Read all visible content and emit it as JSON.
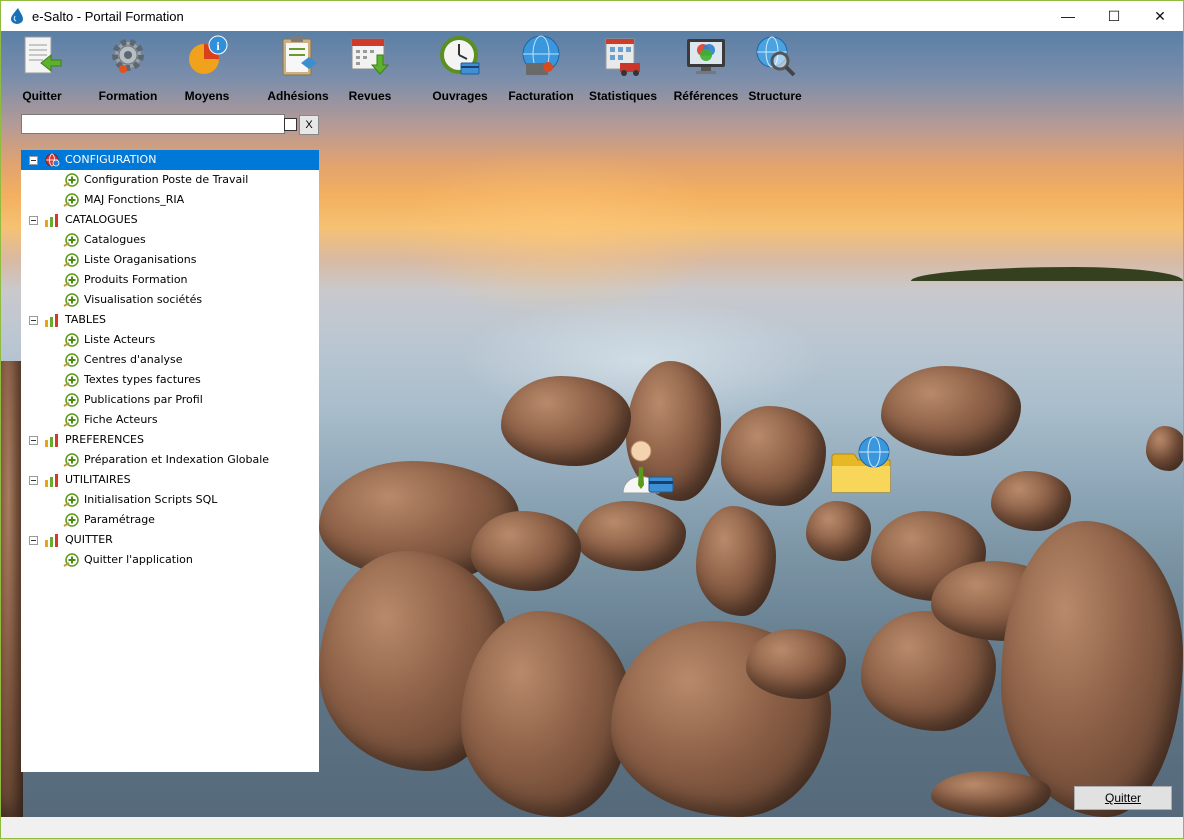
{
  "window": {
    "title": "e-Salto - Portail Formation",
    "minimize": "—",
    "maximize": "☐",
    "close": "✕"
  },
  "toolbar": [
    {
      "label": "Quitter",
      "icon": "document-exit-icon"
    },
    {
      "label": "Formation",
      "icon": "gear-icon"
    },
    {
      "label": "Moyens",
      "icon": "pie-info-icon"
    },
    {
      "label": "Adhésions",
      "icon": "clipboard-icon"
    },
    {
      "label": "Revues",
      "icon": "calendar-download-icon"
    },
    {
      "label": "Ouvrages",
      "icon": "clock-card-icon"
    },
    {
      "label": "Facturation",
      "icon": "globe-card-icon"
    },
    {
      "label": "Statistiques",
      "icon": "building-truck-icon"
    },
    {
      "label": "Références",
      "icon": "monitor-color-icon"
    },
    {
      "label": "Structure",
      "icon": "globe-search-icon"
    }
  ],
  "search": {
    "value": "",
    "clear_label": "X"
  },
  "tree": [
    {
      "type": "category",
      "label": "CONFIGURATION",
      "selected": true
    },
    {
      "type": "leaf",
      "label": "Configuration Poste de Travail"
    },
    {
      "type": "leaf",
      "label": "MAJ Fonctions_RIA"
    },
    {
      "type": "category",
      "label": "CATALOGUES"
    },
    {
      "type": "leaf",
      "label": "Catalogues"
    },
    {
      "type": "leaf",
      "label": "Liste Oraganisations"
    },
    {
      "type": "leaf",
      "label": "Produits Formation"
    },
    {
      "type": "leaf",
      "label": "Visualisation sociétés"
    },
    {
      "type": "category",
      "label": "TABLES"
    },
    {
      "type": "leaf",
      "label": "Liste Acteurs"
    },
    {
      "type": "leaf",
      "label": "Centres d'analyse"
    },
    {
      "type": "leaf",
      "label": "Textes types factures"
    },
    {
      "type": "leaf",
      "label": "Publications par Profil"
    },
    {
      "type": "leaf",
      "label": "Fiche Acteurs"
    },
    {
      "type": "category",
      "label": "PREFERENCES"
    },
    {
      "type": "leaf",
      "label": "Préparation et Indexation Globale"
    },
    {
      "type": "category",
      "label": "UTILITAIRES"
    },
    {
      "type": "leaf",
      "label": "Initialisation Scripts SQL"
    },
    {
      "type": "leaf",
      "label": "Paramétrage"
    },
    {
      "type": "category",
      "label": "QUITTER"
    },
    {
      "type": "leaf",
      "label": "Quitter l'application"
    }
  ],
  "desktop_icons": [
    {
      "icon": "user-card-icon"
    },
    {
      "icon": "folder-globe-icon"
    }
  ],
  "footer": {
    "quit_label": "Quitter"
  },
  "colors": {
    "selection": "#0078d7",
    "leaf_plus": "#5a9a1a",
    "window_border": "#8fbc3f"
  }
}
